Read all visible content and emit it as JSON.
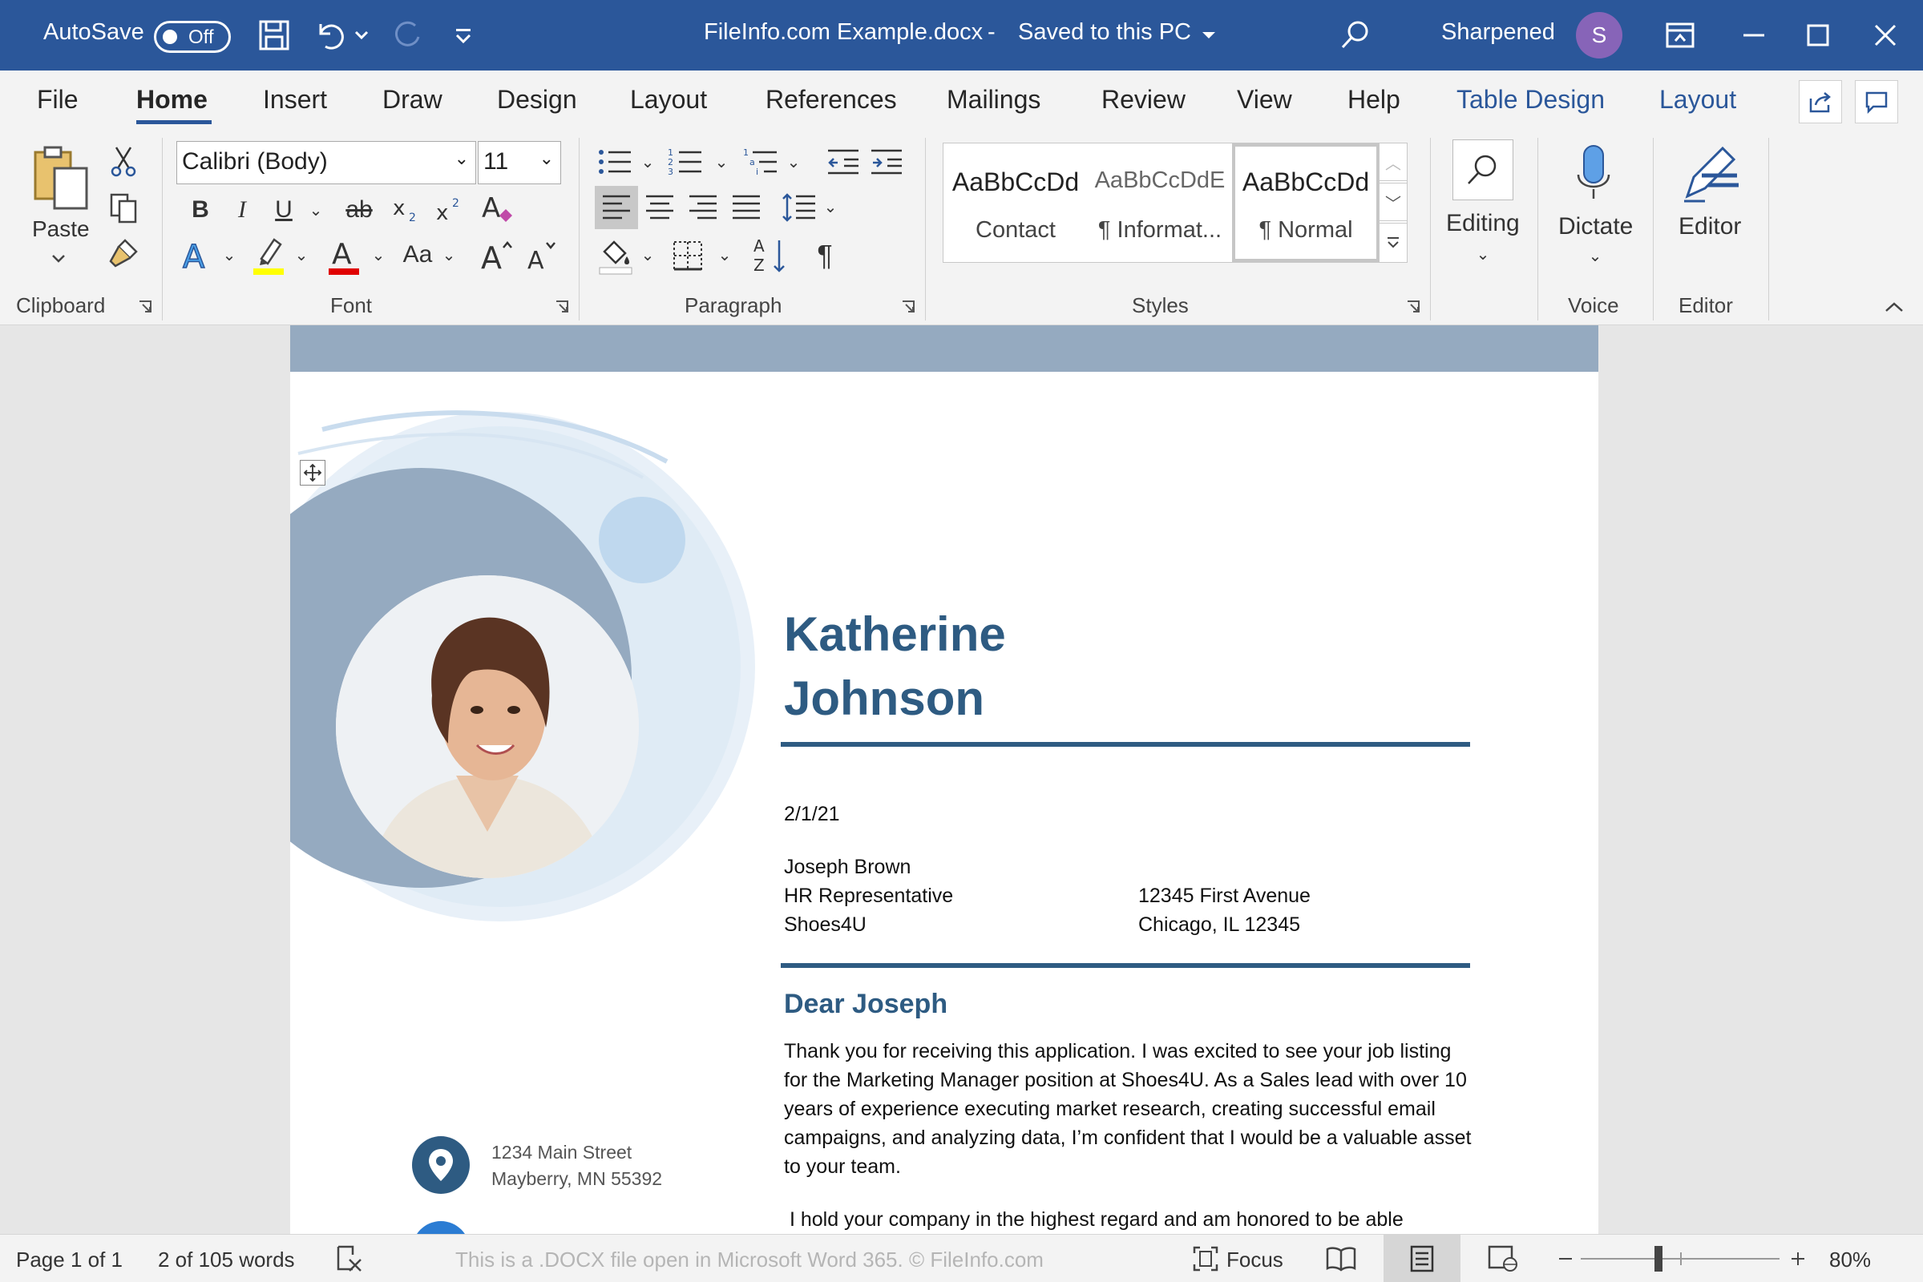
{
  "titlebar": {
    "autosave_label": "AutoSave",
    "autosave_state": "Off",
    "doc_title": "FileInfo.com Example.docx",
    "save_status": "Saved to this PC",
    "user_name": "Sharpened",
    "avatar_initial": "S"
  },
  "tabs": [
    "File",
    "Home",
    "Insert",
    "Draw",
    "Design",
    "Layout",
    "References",
    "Mailings",
    "Review",
    "View",
    "Help",
    "Table Design",
    "Layout"
  ],
  "ribbon": {
    "clipboard": {
      "paste_label": "Paste",
      "group_label": "Clipboard"
    },
    "font": {
      "font_name": "Calibri (Body)",
      "font_size": "11",
      "group_label": "Font",
      "bold": "B",
      "italic": "I",
      "underline": "U",
      "strike": "ab",
      "change_case": "Aa"
    },
    "paragraph": {
      "group_label": "Paragraph"
    },
    "styles": {
      "group_label": "Styles",
      "items": [
        {
          "preview": "AaBbCcDd",
          "name": "Contact"
        },
        {
          "preview": "AaBbCcDdE",
          "name": "¶ Informat..."
        },
        {
          "preview": "AaBbCcDd",
          "name": "¶ Normal"
        }
      ]
    },
    "editing": {
      "label": "Editing"
    },
    "voice": {
      "label": "Dictate",
      "group_label": "Voice"
    },
    "editor": {
      "label": "Editor",
      "group_label": "Editor"
    }
  },
  "document": {
    "first_name": "Katherine",
    "last_name": "Johnson",
    "date": "2/1/21",
    "recipient": {
      "name": "Joseph Brown",
      "title": "HR Representative",
      "company": "Shoes4U",
      "street": "12345 First Avenue",
      "city": "Chicago, IL 12345"
    },
    "greeting": "Dear Joseph",
    "paragraph1": "Thank you for receiving this application.  I was excited to see your job listing for the Marketing Manager position at Shoes4U.  As a Sales lead with over 10 years of experience executing market research, creating successful email campaigns, and analyzing data, I’m confident that I would be a valuable asset to your team.",
    "paragraph2": " I hold your company in the highest regard and am honored to be able",
    "sender_address_line1": "1234 Main Street",
    "sender_address_line2": "Mayberry, MN 55392"
  },
  "statusbar": {
    "page": "Page 1 of 1",
    "words": "2 of 105 words",
    "watermark": "This is a .DOCX file open in Microsoft Word 365. © FileInfo.com",
    "focus": "Focus",
    "zoom": "80%"
  },
  "colors": {
    "titlebar": "#2b579a",
    "accent_text": "#2e5b82",
    "band": "#95aac0",
    "avatar": "#8764b8"
  }
}
